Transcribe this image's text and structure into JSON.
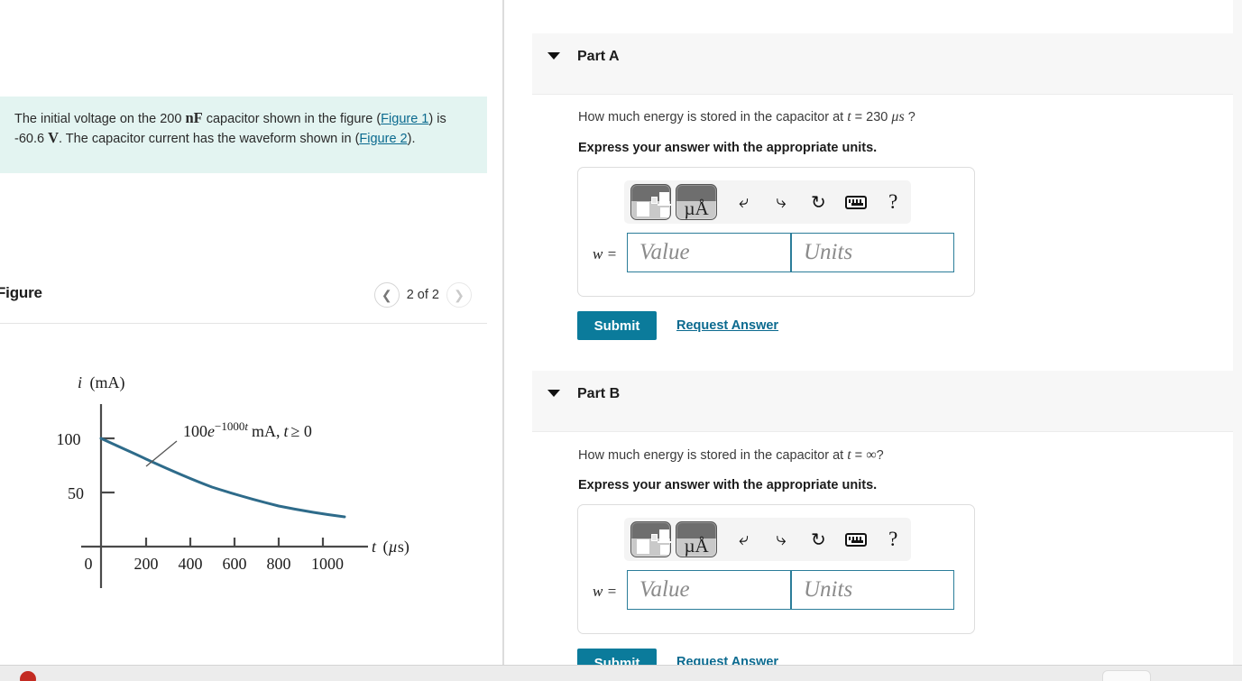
{
  "left": {
    "problem": {
      "seg1": "The initial voltage on the 200 ",
      "unit_nf": "nF",
      "seg2": " capacitor shown in the figure (",
      "link1": "Figure 1",
      "seg3": ") is -60.6 ",
      "unit_v": "V",
      "seg4": ". The capacitor current has the waveform shown in (",
      "link2": "Figure 2",
      "seg5": ")."
    },
    "figure": {
      "title": "Figure",
      "counter": "2 of 2",
      "prev_icon": "chevron-left-icon",
      "next_icon": "chevron-right-icon"
    }
  },
  "chart_data": {
    "type": "line",
    "title": "",
    "xlabel": "t (μs)",
    "ylabel": "i (mA)",
    "annotation": "100e^{-1000t} mA, t ≥ 0",
    "x_ticks": [
      0,
      200,
      400,
      600,
      800,
      1000
    ],
    "x_tick_labels": [
      "0",
      "200",
      "400",
      "600",
      "800",
      "1000"
    ],
    "y_ticks": [
      50,
      100
    ],
    "y_tick_labels": [
      "50",
      "100"
    ],
    "xlim": [
      0,
      1150
    ],
    "ylim": [
      0,
      120
    ],
    "grid": false,
    "legend": "none",
    "series": [
      {
        "name": "i(t) = 100e^(-1000t) mA",
        "color": "#2e6b8a",
        "x": [
          0,
          100,
          200,
          300,
          400,
          500,
          600,
          700,
          800,
          900,
          1000
        ],
        "y": [
          100,
          90.5,
          81.9,
          74.1,
          67.0,
          60.7,
          54.9,
          49.7,
          44.9,
          40.7,
          36.8
        ]
      }
    ]
  },
  "right": {
    "parts": [
      {
        "header_label": "Part A",
        "caret_icon": "caret-down-icon",
        "question_pre": "How much energy is stored in the capacitor at ",
        "question_var": "t",
        "question_post": " = 230 ",
        "question_unit": "μs",
        "question_tail": " ?",
        "instruction": "Express your answer with the appropriate units.",
        "toolbar": {
          "template_icon": "math-template-icon",
          "units_icon": "micro-angstrom-units-icon",
          "undo_icon": "undo-icon",
          "redo_icon": "redo-icon",
          "reset_icon": "reset-icon",
          "keyboard_icon": "keyboard-icon",
          "help_icon": "help-question-icon"
        },
        "label": "w =",
        "value_placeholder": "Value",
        "units_placeholder": "Units",
        "submit_label": "Submit",
        "request_label": "Request Answer"
      },
      {
        "header_label": "Part B",
        "caret_icon": "caret-down-icon",
        "question_pre": "How much energy is stored in the capacitor at ",
        "question_var": "t",
        "question_post": " = ",
        "question_unit": "∞",
        "question_tail": "?",
        "instruction": "Express your answer with the appropriate units.",
        "toolbar": {
          "template_icon": "math-template-icon",
          "units_icon": "micro-angstrom-units-icon",
          "undo_icon": "undo-icon",
          "redo_icon": "redo-icon",
          "reset_icon": "reset-icon",
          "keyboard_icon": "keyboard-icon",
          "help_icon": "help-question-icon"
        },
        "label": "w =",
        "value_placeholder": "Value",
        "units_placeholder": "Units",
        "submit_label": "Submit",
        "request_label": "Request Answer"
      }
    ]
  },
  "colors": {
    "accent": "#0b7b9b",
    "link": "#0b6a8f",
    "problem_bg": "#e3f4f1",
    "header_bg": "#f7f7f7",
    "field_border": "#2b7d99",
    "curve": "#2e6b8a"
  }
}
